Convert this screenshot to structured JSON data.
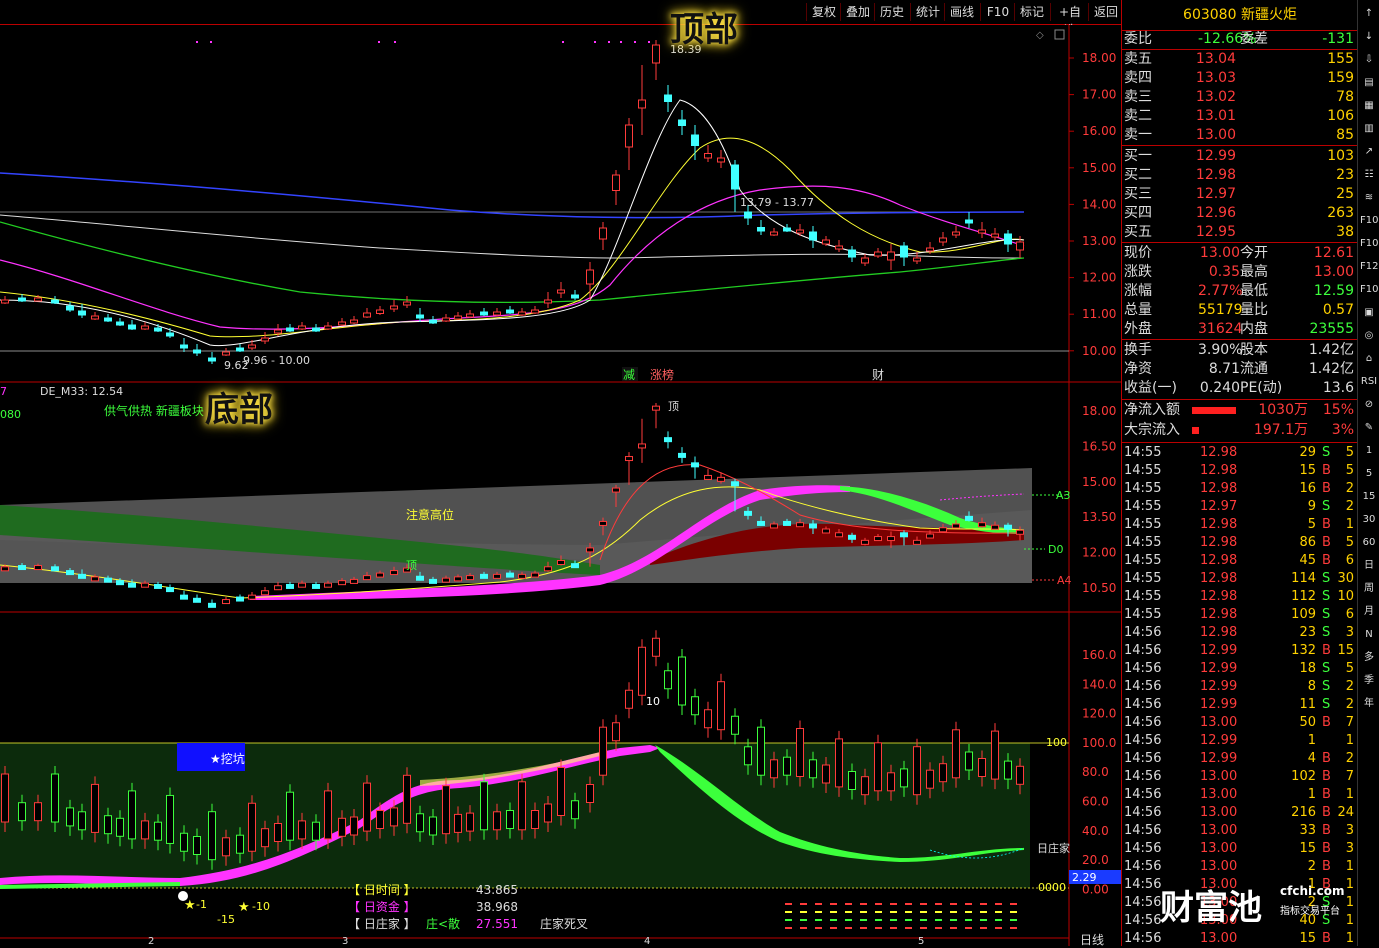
{
  "toolbar": {
    "buttons": [
      "复权",
      "叠加",
      "历史",
      "统计",
      "画线",
      "F10",
      "标记",
      "+自选",
      "返回"
    ]
  },
  "stock": {
    "code": "603080",
    "name": "新疆火炬"
  },
  "annotations": {
    "top": "顶部",
    "bottom": "底部"
  },
  "main_chart": {
    "price_axis": [
      "18.00",
      "17.00",
      "16.00",
      "15.00",
      "14.00",
      "13.00",
      "12.00",
      "11.00",
      "10.00"
    ],
    "high_label": "18.39",
    "low_label": "9.62",
    "low_range_label": "9.96 - 10.00",
    "mid_label": "13.79 - 13.77",
    "event_labels": {
      "jian": "减",
      "zhangbang": "涨榜",
      "cai": "财"
    }
  },
  "sub1": {
    "header": "DE_M33: 12.54",
    "left_num": "080",
    "left_num_top": "7",
    "subtitle": "供气供热 新疆板块",
    "price_axis": [
      "18.00",
      "16.50",
      "15.00",
      "13.50",
      "12.00",
      "10.50"
    ],
    "note": "注意高位",
    "top_mark": "顶",
    "top_mark2": "顶",
    "level_a3": "A3",
    "level_d0": "D0",
    "level_a4": "A4"
  },
  "sub2": {
    "axis": [
      "160.0",
      "140.0",
      "120.0",
      "100.0",
      "80.0",
      "60.0",
      "40.0",
      "20.0",
      "0.00"
    ],
    "level_100": "100",
    "level_0": "0000",
    "label_rizhuangjia": "日庄家",
    "value_box": "2.29",
    "wakeng": "★挖坑",
    "mark_10": "10",
    "mark_neg15": "-15",
    "mark_neg10": "-10",
    "mark_neg1": "-1",
    "legend": [
      {
        "label": "【 日时间 】",
        "value": "43.865"
      },
      {
        "label": "【 日资金 】",
        "value": "38.968"
      },
      {
        "label": "【 日庄家 】",
        "value": "27.551",
        "extra": "庄<散",
        "extra2": "庄家死叉"
      }
    ]
  },
  "x_axis_marks": [
    "2",
    "3",
    "4",
    "5"
  ],
  "bottom_right_label": "日线",
  "quote": {
    "weibi": {
      "label": "委比",
      "value": "-12.66%",
      "label2": "委差",
      "value2": "-131"
    },
    "asks": [
      {
        "label": "卖五",
        "price": "13.04",
        "vol": "155"
      },
      {
        "label": "卖四",
        "price": "13.03",
        "vol": "159"
      },
      {
        "label": "卖三",
        "price": "13.02",
        "vol": "78"
      },
      {
        "label": "卖二",
        "price": "13.01",
        "vol": "106"
      },
      {
        "label": "卖一",
        "price": "13.00",
        "vol": "85"
      }
    ],
    "bids": [
      {
        "label": "买一",
        "price": "12.99",
        "vol": "103"
      },
      {
        "label": "买二",
        "price": "12.98",
        "vol": "23"
      },
      {
        "label": "买三",
        "price": "12.97",
        "vol": "25"
      },
      {
        "label": "买四",
        "price": "12.96",
        "vol": "263"
      },
      {
        "label": "买五",
        "price": "12.95",
        "vol": "38"
      }
    ],
    "stats": [
      {
        "l1": "现价",
        "v1": "13.00",
        "l2": "今开",
        "v2": "12.61",
        "c1": "#ff3b3b",
        "c2": "#ff3b3b"
      },
      {
        "l1": "涨跌",
        "v1": "0.35",
        "l2": "最高",
        "v2": "13.00",
        "c1": "#ff3b3b",
        "c2": "#ff3b3b"
      },
      {
        "l1": "涨幅",
        "v1": "2.77%",
        "l2": "最低",
        "v2": "12.59",
        "c1": "#ff3b3b",
        "c2": "#3cff3c"
      },
      {
        "l1": "总量",
        "v1": "55179",
        "l2": "量比",
        "v2": "0.57",
        "c1": "#ffd200",
        "c2": "#ffd200"
      },
      {
        "l1": "外盘",
        "v1": "31624",
        "l2": "内盘",
        "v2": "23555",
        "c1": "#ff3b3b",
        "c2": "#3cff3c"
      }
    ],
    "stats2": [
      {
        "l1": "换手",
        "v1": "3.90%",
        "l2": "股本",
        "v2": "1.42亿",
        "c1": "#ddd",
        "c2": "#ddd"
      },
      {
        "l1": "净资",
        "v1": "8.71",
        "l2": "流通",
        "v2": "1.42亿",
        "c1": "#ddd",
        "c2": "#ddd"
      },
      {
        "l1": "收益(一)",
        "v1": "0.240",
        "l2": "PE(动)",
        "v2": "13.6",
        "c1": "#ddd",
        "c2": "#ddd"
      }
    ],
    "flows": [
      {
        "label": "净流入额",
        "value": "1030万",
        "pct": "15%",
        "bar": 0.8
      },
      {
        "label": "大宗流入",
        "value": "197.1万",
        "pct": "3%",
        "bar": 0.12
      }
    ]
  },
  "ticks": [
    {
      "t": "14:55",
      "p": "12.98",
      "v": "29",
      "bs": "S",
      "n": "5"
    },
    {
      "t": "14:55",
      "p": "12.98",
      "v": "15",
      "bs": "B",
      "n": "5"
    },
    {
      "t": "14:55",
      "p": "12.98",
      "v": "16",
      "bs": "B",
      "n": "2"
    },
    {
      "t": "14:55",
      "p": "12.97",
      "v": "9",
      "bs": "S",
      "n": "2"
    },
    {
      "t": "14:55",
      "p": "12.98",
      "v": "5",
      "bs": "B",
      "n": "1"
    },
    {
      "t": "14:55",
      "p": "12.98",
      "v": "86",
      "bs": "B",
      "n": "5"
    },
    {
      "t": "14:55",
      "p": "12.98",
      "v": "45",
      "bs": "B",
      "n": "6"
    },
    {
      "t": "14:55",
      "p": "12.98",
      "v": "114",
      "bs": "S",
      "n": "30"
    },
    {
      "t": "14:55",
      "p": "12.98",
      "v": "112",
      "bs": "S",
      "n": "10"
    },
    {
      "t": "14:55",
      "p": "12.98",
      "v": "109",
      "bs": "S",
      "n": "6"
    },
    {
      "t": "14:56",
      "p": "12.98",
      "v": "23",
      "bs": "S",
      "n": "3"
    },
    {
      "t": "14:56",
      "p": "12.99",
      "v": "132",
      "bs": "B",
      "n": "15"
    },
    {
      "t": "14:56",
      "p": "12.99",
      "v": "18",
      "bs": "S",
      "n": "5"
    },
    {
      "t": "14:56",
      "p": "12.99",
      "v": "8",
      "bs": "S",
      "n": "2"
    },
    {
      "t": "14:56",
      "p": "12.99",
      "v": "11",
      "bs": "S",
      "n": "2"
    },
    {
      "t": "14:56",
      "p": "13.00",
      "v": "50",
      "bs": "B",
      "n": "7"
    },
    {
      "t": "14:56",
      "p": "12.99",
      "v": "1",
      "bs": "",
      "n": "1"
    },
    {
      "t": "14:56",
      "p": "12.99",
      "v": "4",
      "bs": "B",
      "n": "2"
    },
    {
      "t": "14:56",
      "p": "13.00",
      "v": "102",
      "bs": "B",
      "n": "7"
    },
    {
      "t": "14:56",
      "p": "13.00",
      "v": "1",
      "bs": "B",
      "n": "1"
    },
    {
      "t": "14:56",
      "p": "13.00",
      "v": "216",
      "bs": "B",
      "n": "24"
    },
    {
      "t": "14:56",
      "p": "13.00",
      "v": "33",
      "bs": "B",
      "n": "3"
    },
    {
      "t": "14:56",
      "p": "13.00",
      "v": "15",
      "bs": "B",
      "n": "3"
    },
    {
      "t": "14:56",
      "p": "13.00",
      "v": "2",
      "bs": "B",
      "n": "1"
    },
    {
      "t": "14:56",
      "p": "13.00",
      "v": "1",
      "bs": "B",
      "n": "1"
    },
    {
      "t": "14:56",
      "p": "13.00",
      "v": "2",
      "bs": "S",
      "n": "1"
    },
    {
      "t": "14:56",
      "p": "13.00",
      "v": "40",
      "bs": "S",
      "n": "1"
    },
    {
      "t": "14:56",
      "p": "13.00",
      "v": "15",
      "bs": "B",
      "n": "1"
    }
  ],
  "side_icons": [
    "↑",
    "↓",
    "⇩",
    "▤",
    "▦",
    "▥",
    "↗",
    "☷",
    "≋",
    "F10",
    "F10",
    "F12",
    "F10",
    "▣",
    "◎",
    "⌂",
    "RSI",
    "⊘",
    "✎",
    "1",
    "5",
    "15",
    "30",
    "60",
    "日",
    "周",
    "月",
    "N",
    "多",
    "季",
    "年"
  ],
  "watermark": {
    "logo": "财富池",
    "site": "cfchi.com",
    "slogan": "指标交易平台"
  }
}
